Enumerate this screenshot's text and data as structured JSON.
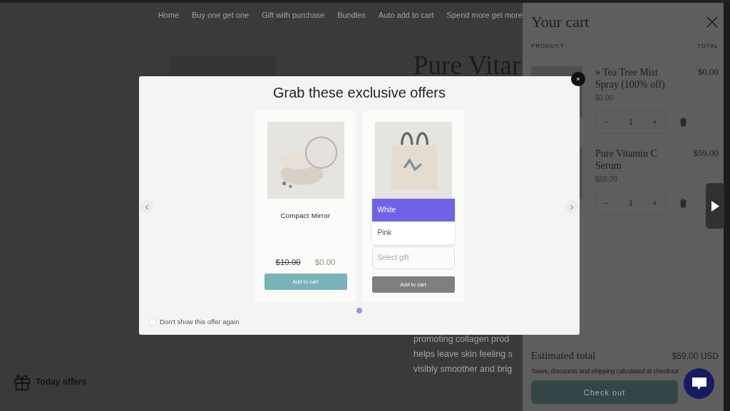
{
  "nav": [
    "Home",
    "Buy one get one",
    "Gift with purchase",
    "Bundles",
    "Auto add to cart",
    "Spend more get more"
  ],
  "product": {
    "title": "Pure Vitar",
    "description": [
      "promoting collagen prod",
      "helps leave skin feeling s",
      "visibly smoother and brig"
    ]
  },
  "today_offers": {
    "label": "Today offers"
  },
  "cart": {
    "title": "Your cart",
    "columns": [
      "PRODUCT",
      "TOTAL"
    ],
    "items": [
      {
        "name": "» Tea Tree Mist Spray (100% off)",
        "total": "$0.00",
        "unit_price": "$0.00",
        "quantity": "1",
        "minus": "−",
        "plus": "+"
      },
      {
        "name": "Pure Vitamin C Serum",
        "total": "$59.00",
        "unit_price": "$59.00",
        "quantity": "1",
        "minus": "−",
        "plus": "+"
      }
    ],
    "estimated_label": "Estimated total",
    "estimated_value": "$59.00 USD",
    "note": "Taxes, discounts and shipping calculated at checkout",
    "checkout": "Check out"
  },
  "modal": {
    "title": "Grab these exclusive offers",
    "close": "×",
    "prev": "‹",
    "next": "›",
    "offers": [
      {
        "kind": "simple",
        "name": "Compact Mirror",
        "old_price": "$10.00",
        "price": "$0.00",
        "button": "Add to cart",
        "disabled": false
      },
      {
        "kind": "variant",
        "options": [
          {
            "label": "White",
            "selected": true
          },
          {
            "label": "Pink",
            "selected": false
          }
        ],
        "placeholder": "Select gift",
        "button": "Add to cart",
        "disabled": true
      }
    ],
    "pages": [
      {
        "selected": true
      }
    ],
    "dont_show": {
      "label": "Don't show this offer again",
      "checked": false
    }
  }
}
